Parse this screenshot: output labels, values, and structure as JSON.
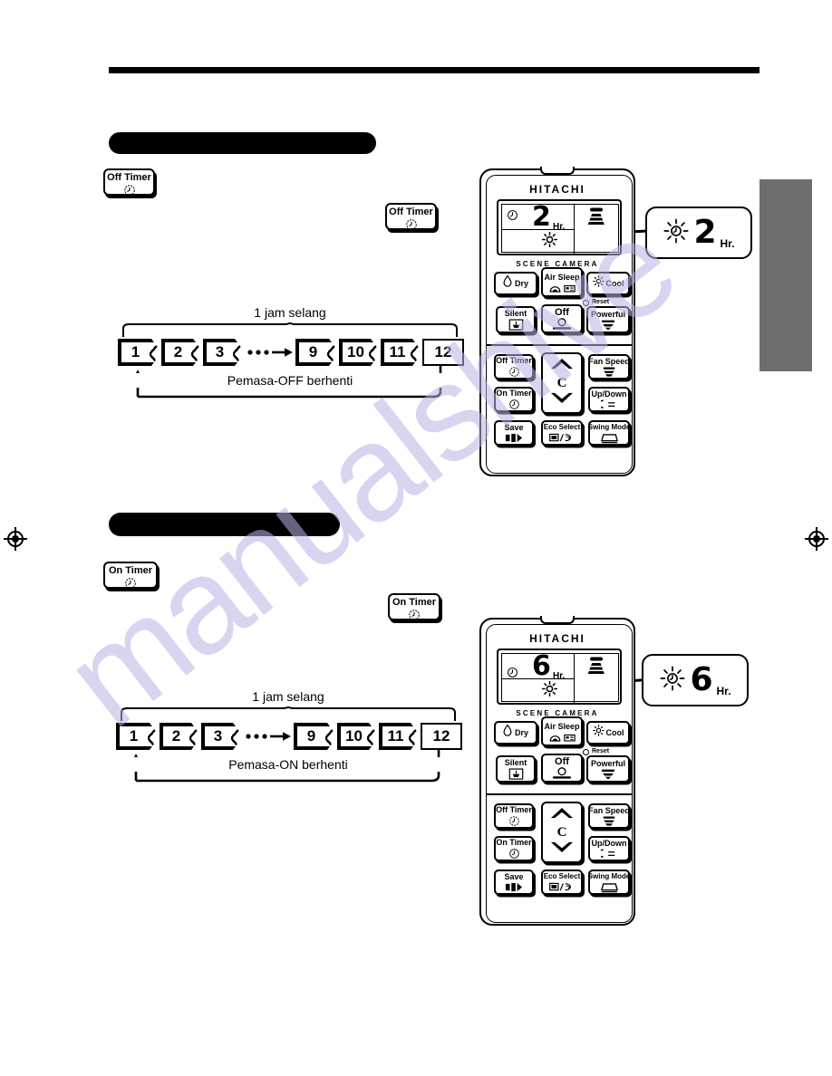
{
  "page": {
    "language_note": "Malay",
    "watermark": "manualshive"
  },
  "sections": [
    {
      "id": "off-timer",
      "heading_redacted": true,
      "heading_text": "",
      "key_badge_primary": {
        "label": "Off Timer",
        "icon": "clock-icon"
      },
      "key_badge_secondary": {
        "label": "Off Timer",
        "icon": "clock-icon"
      },
      "timeline": {
        "caption": "1 jam selang",
        "steps": [
          "1",
          "2",
          "3",
          "⋯→",
          "9",
          "10",
          "11",
          "12"
        ],
        "loop_label": "Pemasa-OFF berhenti"
      },
      "remote": {
        "brand": "HITACHI",
        "lcd": {
          "timer_icon": "off-timer-clock-icon",
          "value": "2",
          "unit": "Hr.",
          "fan_icon": "fan-speed-icon",
          "mode_icon": "cool-sun-icon"
        },
        "lcd_caption": "SCENE CAMERA",
        "buttons_top": [
          {
            "label": "Dry",
            "icon": "droplet-icon"
          },
          {
            "label": "Air Sleep",
            "icon": "air-sleep-icon"
          },
          {
            "label": "Cool",
            "icon": "sun-icon"
          },
          {
            "label": "Silent",
            "icon": "silent-icon"
          },
          {
            "label": "Off",
            "icon": "power-off-icon"
          },
          {
            "label": "Powerful",
            "icon": "powerful-icon"
          }
        ],
        "reset_label": "Reset",
        "buttons_bottom": [
          {
            "label": "Off Timer",
            "icon": "clock-icon"
          },
          {
            "label": "Fan Speed",
            "icon": "fan-icon"
          },
          {
            "label": "On Timer",
            "icon": "clock-icon"
          },
          {
            "label": "Up/Down",
            "icon": "louver-icon"
          },
          {
            "label": "Save",
            "icon": "save-icon"
          },
          {
            "label": "Eco Select",
            "icon": "eco-icon"
          },
          {
            "label": "Swing Mode",
            "icon": "swing-icon"
          }
        ],
        "temp_unit": "C",
        "temp_up_icon": "chevron-up-icon",
        "temp_down_icon": "chevron-down-icon"
      },
      "callout": {
        "icon": "blinking-clock-icon",
        "value": "2",
        "unit": "Hr.",
        "blinking": true
      }
    },
    {
      "id": "on-timer",
      "heading_redacted": true,
      "heading_text": "",
      "key_badge_primary": {
        "label": "On Timer",
        "icon": "clock-icon"
      },
      "key_badge_secondary": {
        "label": "On Timer",
        "icon": "clock-icon"
      },
      "timeline": {
        "caption": "1 jam selang",
        "steps": [
          "1",
          "2",
          "3",
          "⋯→",
          "9",
          "10",
          "11",
          "12"
        ],
        "loop_label": "Pemasa-ON  berhenti"
      },
      "remote": {
        "brand": "HITACHI",
        "lcd": {
          "timer_icon": "on-timer-clock-icon",
          "value": "6",
          "unit": "Hr.",
          "fan_icon": "fan-speed-icon",
          "mode_icon": "cool-sun-icon"
        },
        "lcd_caption": "SCENE CAMERA",
        "buttons_top": [
          {
            "label": "Dry",
            "icon": "droplet-icon"
          },
          {
            "label": "Air Sleep",
            "icon": "air-sleep-icon"
          },
          {
            "label": "Cool",
            "icon": "sun-icon"
          },
          {
            "label": "Silent",
            "icon": "silent-icon"
          },
          {
            "label": "Off",
            "icon": "power-off-icon"
          },
          {
            "label": "Powerful",
            "icon": "powerful-icon"
          }
        ],
        "reset_label": "Reset",
        "buttons_bottom": [
          {
            "label": "Off Timer",
            "icon": "clock-icon"
          },
          {
            "label": "Fan Speed",
            "icon": "fan-icon"
          },
          {
            "label": "On Timer",
            "icon": "clock-icon"
          },
          {
            "label": "Up/Down",
            "icon": "louver-icon"
          },
          {
            "label": "Save",
            "icon": "save-icon"
          },
          {
            "label": "Eco Select",
            "icon": "eco-icon"
          },
          {
            "label": "Swing Mode",
            "icon": "swing-icon"
          }
        ],
        "temp_unit": "C",
        "temp_up_icon": "chevron-up-icon",
        "temp_down_icon": "chevron-down-icon"
      },
      "callout": {
        "icon": "blinking-clock-icon",
        "value": "6",
        "unit": "Hr.",
        "blinking": true
      }
    }
  ],
  "colors": {
    "ink": "#000000",
    "paper": "#ffffff",
    "thumb_tab": "#6e6e6e",
    "watermark": "#b9b4e6"
  }
}
